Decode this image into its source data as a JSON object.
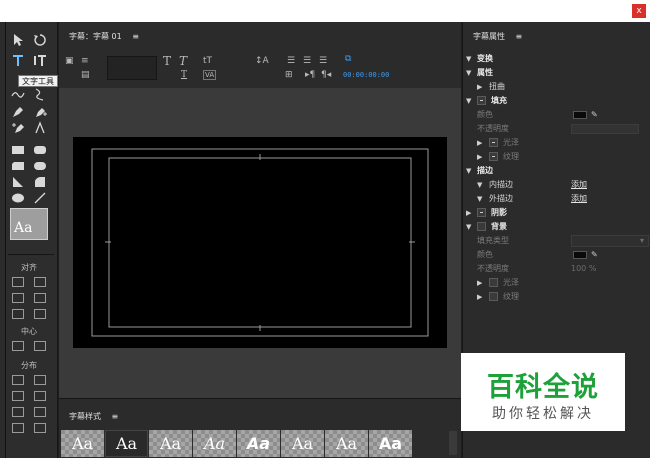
{
  "window": {
    "close_label": "x"
  },
  "tools": {
    "tooltip": "文字工具",
    "style_swatch": "Aa"
  },
  "align": {
    "label": "对齐",
    "center_label": "中心",
    "distribute_label": "分布"
  },
  "title_panel": {
    "title": "字幕：字幕 01",
    "menu_glyph": "≡"
  },
  "toolbar": {
    "timecode": "00:00:00:00",
    "value_label": "VA"
  },
  "styles_panel": {
    "title": "字幕样式",
    "menu_glyph": "≡",
    "samples": [
      "Aa",
      "Aa",
      "Aa",
      "Aa",
      "Aa",
      "Aa",
      "Aa",
      "Aa"
    ]
  },
  "properties_panel": {
    "title": "字幕属性",
    "menu_glyph": "≡",
    "transform": "变换",
    "attributes": "属性",
    "distort": "扭曲",
    "fill": "填充",
    "color": "颜色",
    "opacity": "不透明度",
    "sheen": "光泽",
    "texture": "纹理",
    "strokes": "描边",
    "inner_stroke": "内描边",
    "outer_stroke": "外描边",
    "add_link": "添加",
    "shadow": "阴影",
    "background": "背景",
    "fill_type": "填充类型",
    "bg_color": "颜色",
    "bg_opacity": "不透明度",
    "bg_opacity_value": "100 %",
    "bg_sheen": "光泽",
    "bg_texture": "纹理"
  },
  "watermark": {
    "main": "百科全说",
    "sub": "助你轻松解决"
  },
  "colors": {
    "accent_timecode": "#3b9df2",
    "watermark_green": "#1fa13a",
    "close_red": "#d9302c"
  }
}
